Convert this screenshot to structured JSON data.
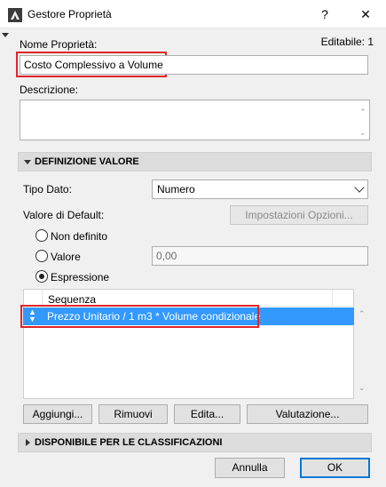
{
  "window": {
    "title": "Gestore Proprietà",
    "help_label": "?",
    "close_label": "✕"
  },
  "property": {
    "name_label": "Nome Proprietà:",
    "name_value": "Costo Complessivo a Volume",
    "editable_label": "Editabile: 1",
    "description_label": "Descrizione:",
    "description_value": ""
  },
  "definition": {
    "section_title": "DEFINIZIONE VALORE",
    "data_type_label": "Tipo Dato:",
    "data_type_value": "Numero",
    "default_label": "Valore di Default:",
    "options_button": "Impostazioni Opzioni...",
    "radios": [
      {
        "label": "Non definito",
        "checked": false
      },
      {
        "label": "Valore",
        "checked": false
      },
      {
        "label": "Espressione",
        "checked": true
      }
    ],
    "value_input": "0,00",
    "list_header": "Sequenza",
    "rows": [
      {
        "text": "Prezzo Unitario / 1 m3 * Volume condizionale",
        "selected": true
      }
    ],
    "buttons": {
      "add": "Aggiungi...",
      "remove": "Rimuovi",
      "edit": "Edita...",
      "evaluate": "Valutazione..."
    }
  },
  "classification": {
    "section_title": "DISPONIBILE PER LE CLASSIFICAZIONI"
  },
  "footer": {
    "cancel": "Annulla",
    "ok": "OK"
  },
  "colors": {
    "selection": "#3399ff",
    "highlight": "#e0242b"
  }
}
